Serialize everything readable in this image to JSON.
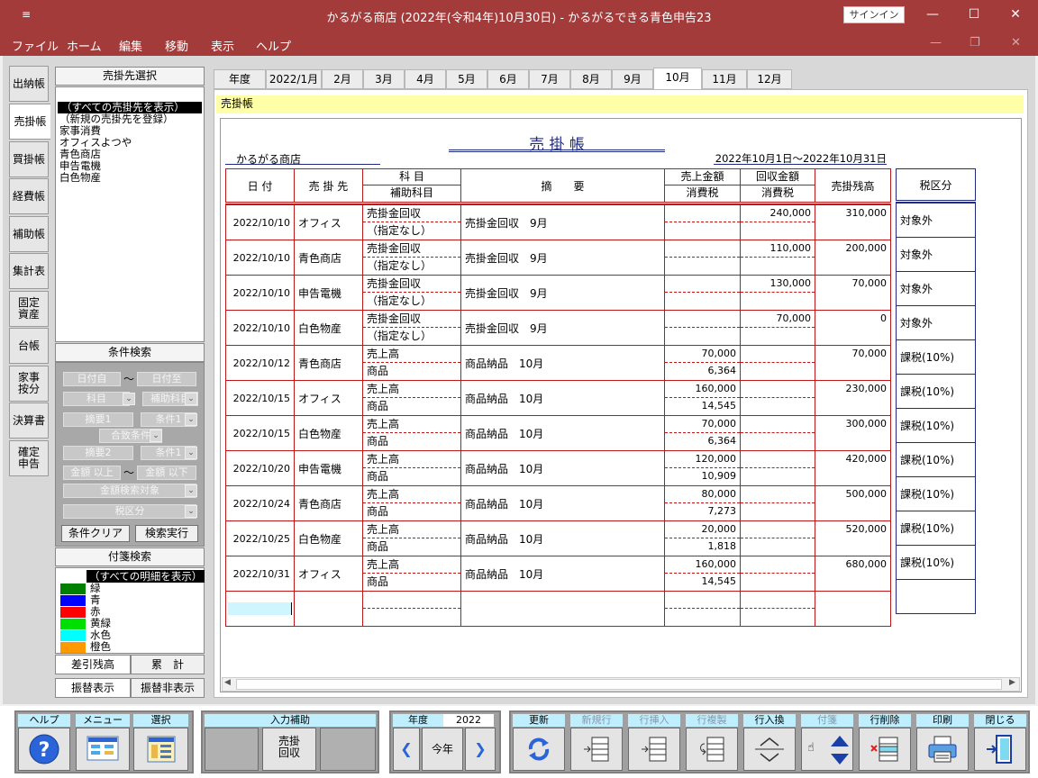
{
  "window": {
    "title": "かるがる商店 (2022年(令和4年)10月30日)  -  かるがるできる青色申告23",
    "signin_label": "サインイン",
    "system_menu_glyph": "≡"
  },
  "menu": [
    "ファイル",
    "ホーム",
    "編集",
    "移動",
    "表示",
    "ヘルプ"
  ],
  "vtabs": [
    "出納帳",
    "売掛帳",
    "買掛帳",
    "経費帳",
    "補助帳",
    "集計表",
    "固定\n資産",
    "台帳",
    "家事\n按分",
    "決算書",
    "確定\n申告"
  ],
  "customer_select": {
    "header": "売掛先選択",
    "items": [
      "（すべての売掛先を表示）",
      "（新規の売掛先を登録）",
      "家事消費",
      "オフィスよつや",
      "青色商店",
      "申告電機",
      "白色物産"
    ],
    "selected_index": 0
  },
  "condition_search": {
    "header": "条件検索",
    "date_from": "日付自",
    "tilde": "～",
    "date_to": "日付至",
    "account": "科目",
    "sub_account": "補助科目",
    "memo1": "摘要1",
    "cond1": "条件1",
    "match_cond": "合致条件",
    "memo2": "摘要2",
    "cond2": "条件1",
    "amount_min": "金額 以上",
    "amount_max": "金額 以下",
    "amount_target": "金額検索対象",
    "tax_class": "税区分",
    "clear_label": "条件クリア",
    "run_label": "検索実行"
  },
  "tag_search": {
    "header": "付箋検索",
    "all_label": "（すべての明細を表示）",
    "tags": [
      {
        "label": "緑",
        "color": "#008000"
      },
      {
        "label": "青",
        "color": "#0000ff"
      },
      {
        "label": "赤",
        "color": "#ff0000"
      },
      {
        "label": "黄緑",
        "color": "#00e000"
      },
      {
        "label": "水色",
        "color": "#00ffff"
      },
      {
        "label": "橙色",
        "color": "#ff9900"
      }
    ]
  },
  "subtabs": {
    "balance": "差引残高",
    "total": "累　計",
    "transfer_show": "振替表示",
    "transfer_hide": "振替非表示"
  },
  "month_tabs": [
    "年度",
    "2022/1月",
    "2月",
    "3月",
    "4月",
    "5月",
    "6月",
    "7月",
    "8月",
    "9月",
    "10月",
    "11月",
    "12月"
  ],
  "active_month_index": 10,
  "ledger": {
    "sheet_label": "売掛帳",
    "title": "売 掛 帳",
    "company": "かるがる商店",
    "period": "2022年10月1日～2022年10月31日",
    "headers": {
      "date": "日 付",
      "customer": "売 掛 先",
      "account": "科 目",
      "sub_account": "補助科目",
      "memo": "摘　　要",
      "sales": "売上金額",
      "sales_tax": "消費税",
      "collect": "回収金額",
      "collect_tax": "消費税",
      "balance": "売掛残高",
      "tax_class": "税区分"
    },
    "rows": [
      {
        "date": "2022/10/10",
        "customer": "オフィス",
        "account": "売掛金回収",
        "sub": "（指定なし）",
        "memo": "売掛金回収　9月",
        "sales": "",
        "tax": "",
        "collect": "240,000",
        "balance": "310,000",
        "tax_class": "対象外"
      },
      {
        "date": "2022/10/10",
        "customer": "青色商店",
        "account": "売掛金回収",
        "sub": "（指定なし）",
        "memo": "売掛金回収　9月",
        "sales": "",
        "tax": "",
        "collect": "110,000",
        "balance": "200,000",
        "tax_class": "対象外"
      },
      {
        "date": "2022/10/10",
        "customer": "申告電機",
        "account": "売掛金回収",
        "sub": "（指定なし）",
        "memo": "売掛金回収　9月",
        "sales": "",
        "tax": "",
        "collect": "130,000",
        "balance": "70,000",
        "tax_class": "対象外"
      },
      {
        "date": "2022/10/10",
        "customer": "白色物産",
        "account": "売掛金回収",
        "sub": "（指定なし）",
        "memo": "売掛金回収　9月",
        "sales": "",
        "tax": "",
        "collect": "70,000",
        "balance": "0",
        "tax_class": "対象外"
      },
      {
        "date": "2022/10/12",
        "customer": "青色商店",
        "account": "売上高",
        "sub": "商品",
        "memo": "商品納品　10月",
        "sales": "70,000",
        "tax": "6,364",
        "collect": "",
        "balance": "70,000",
        "tax_class": "課税(10%)"
      },
      {
        "date": "2022/10/15",
        "customer": "オフィス",
        "account": "売上高",
        "sub": "商品",
        "memo": "商品納品　10月",
        "sales": "160,000",
        "tax": "14,545",
        "collect": "",
        "balance": "230,000",
        "tax_class": "課税(10%)"
      },
      {
        "date": "2022/10/15",
        "customer": "白色物産",
        "account": "売上高",
        "sub": "商品",
        "memo": "商品納品　10月",
        "sales": "70,000",
        "tax": "6,364",
        "collect": "",
        "balance": "300,000",
        "tax_class": "課税(10%)"
      },
      {
        "date": "2022/10/20",
        "customer": "申告電機",
        "account": "売上高",
        "sub": "商品",
        "memo": "商品納品　10月",
        "sales": "120,000",
        "tax": "10,909",
        "collect": "",
        "balance": "420,000",
        "tax_class": "課税(10%)"
      },
      {
        "date": "2022/10/24",
        "customer": "青色商店",
        "account": "売上高",
        "sub": "商品",
        "memo": "商品納品　10月",
        "sales": "80,000",
        "tax": "7,273",
        "collect": "",
        "balance": "500,000",
        "tax_class": "課税(10%)"
      },
      {
        "date": "2022/10/25",
        "customer": "白色物産",
        "account": "売上高",
        "sub": "商品",
        "memo": "商品納品　10月",
        "sales": "20,000",
        "tax": "1,818",
        "collect": "",
        "balance": "520,000",
        "tax_class": "課税(10%)"
      },
      {
        "date": "2022/10/31",
        "customer": "オフィス",
        "account": "売上高",
        "sub": "商品",
        "memo": "商品納品　10月",
        "sales": "160,000",
        "tax": "14,545",
        "collect": "",
        "balance": "680,000",
        "tax_class": "課税(10%)"
      }
    ]
  },
  "toolbar": {
    "help": "ヘルプ",
    "menu": "メニュー",
    "select": "選択",
    "input_assist": "入力補助",
    "collect_btn": "売掛\n回収",
    "year_label": "年度",
    "year_value": "2022",
    "this_year": "今年",
    "refresh": "更新",
    "new_row": "新規行",
    "insert_row": "行挿入",
    "copy_row": "行複製",
    "swap_row": "行入換",
    "tag": "付箋",
    "delete_row": "行削除",
    "print": "印刷",
    "close": "閉じる"
  }
}
